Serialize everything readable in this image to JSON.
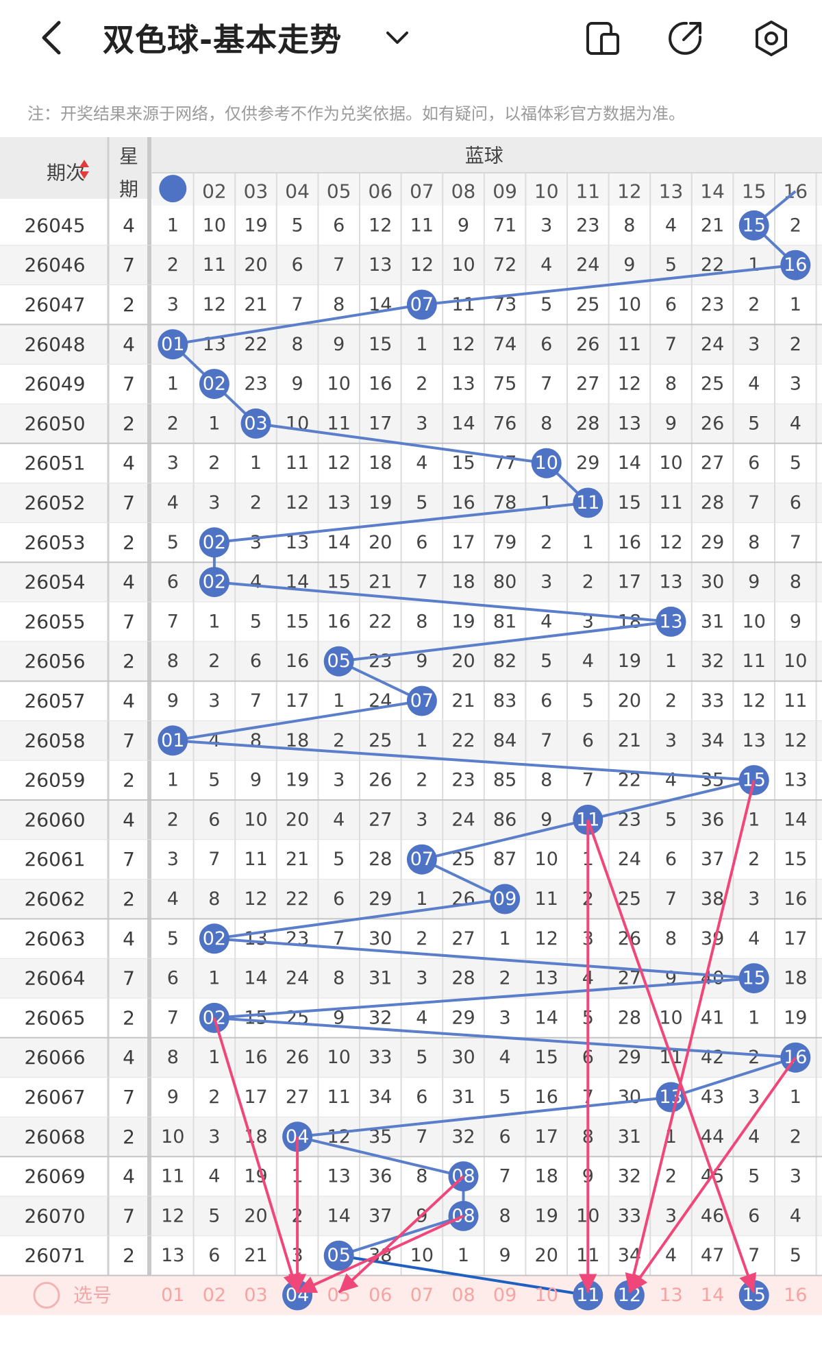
{
  "header": {
    "title": "双色球-基本走势",
    "note": "注：开奖结果来源于网络，仅供参考不作为兑奖依据。如有疑问，以福体彩官方数据为准。",
    "icons": [
      "back-icon",
      "chevron-down-icon",
      "device-icon",
      "share-icon",
      "settings-icon"
    ]
  },
  "table": {
    "col_issue": "期次",
    "col_week": "星期",
    "group_label": "蓝球",
    "columns": [
      "01",
      "02",
      "03",
      "04",
      "05",
      "06",
      "07",
      "08",
      "09",
      "10",
      "11",
      "12",
      "13",
      "14",
      "15",
      "16"
    ],
    "rows": [
      {
        "issue": "26045",
        "week": "4",
        "blue": 15,
        "cells": [
          "1",
          "10",
          "19",
          "5",
          "6",
          "12",
          "11",
          "9",
          "71",
          "3",
          "23",
          "8",
          "4",
          "21",
          "15",
          "2"
        ]
      },
      {
        "issue": "26046",
        "week": "7",
        "blue": 16,
        "cells": [
          "2",
          "11",
          "20",
          "6",
          "7",
          "13",
          "12",
          "10",
          "72",
          "4",
          "24",
          "9",
          "5",
          "22",
          "1",
          "16"
        ]
      },
      {
        "issue": "26047",
        "week": "2",
        "blue": 7,
        "cells": [
          "3",
          "12",
          "21",
          "7",
          "8",
          "14",
          "07",
          "11",
          "73",
          "5",
          "25",
          "10",
          "6",
          "23",
          "2",
          "1"
        ]
      },
      {
        "issue": "26048",
        "week": "4",
        "blue": 1,
        "cells": [
          "01",
          "13",
          "22",
          "8",
          "9",
          "15",
          "1",
          "12",
          "74",
          "6",
          "26",
          "11",
          "7",
          "24",
          "3",
          "2"
        ]
      },
      {
        "issue": "26049",
        "week": "7",
        "blue": 2,
        "cells": [
          "1",
          "02",
          "23",
          "9",
          "10",
          "16",
          "2",
          "13",
          "75",
          "7",
          "27",
          "12",
          "8",
          "25",
          "4",
          "3"
        ]
      },
      {
        "issue": "26050",
        "week": "2",
        "blue": 3,
        "cells": [
          "2",
          "1",
          "03",
          "10",
          "11",
          "17",
          "3",
          "14",
          "76",
          "8",
          "28",
          "13",
          "9",
          "26",
          "5",
          "4"
        ]
      },
      {
        "issue": "26051",
        "week": "4",
        "blue": 10,
        "cells": [
          "3",
          "2",
          "1",
          "11",
          "12",
          "18",
          "4",
          "15",
          "77",
          "10",
          "29",
          "14",
          "10",
          "27",
          "6",
          "5"
        ]
      },
      {
        "issue": "26052",
        "week": "7",
        "blue": 11,
        "cells": [
          "4",
          "3",
          "2",
          "12",
          "13",
          "19",
          "5",
          "16",
          "78",
          "1",
          "11",
          "15",
          "11",
          "28",
          "7",
          "6"
        ]
      },
      {
        "issue": "26053",
        "week": "2",
        "blue": 2,
        "cells": [
          "5",
          "02",
          "3",
          "13",
          "14",
          "20",
          "6",
          "17",
          "79",
          "2",
          "1",
          "16",
          "12",
          "29",
          "8",
          "7"
        ]
      },
      {
        "issue": "26054",
        "week": "4",
        "blue": 2,
        "cells": [
          "6",
          "02",
          "4",
          "14",
          "15",
          "21",
          "7",
          "18",
          "80",
          "3",
          "2",
          "17",
          "13",
          "30",
          "9",
          "8"
        ]
      },
      {
        "issue": "26055",
        "week": "7",
        "blue": 13,
        "cells": [
          "7",
          "1",
          "5",
          "15",
          "16",
          "22",
          "8",
          "19",
          "81",
          "4",
          "3",
          "18",
          "13",
          "31",
          "10",
          "9"
        ]
      },
      {
        "issue": "26056",
        "week": "2",
        "blue": 5,
        "cells": [
          "8",
          "2",
          "6",
          "16",
          "05",
          "23",
          "9",
          "20",
          "82",
          "5",
          "4",
          "19",
          "1",
          "32",
          "11",
          "10"
        ]
      },
      {
        "issue": "26057",
        "week": "4",
        "blue": 7,
        "cells": [
          "9",
          "3",
          "7",
          "17",
          "1",
          "24",
          "07",
          "21",
          "83",
          "6",
          "5",
          "20",
          "2",
          "33",
          "12",
          "11"
        ]
      },
      {
        "issue": "26058",
        "week": "7",
        "blue": 1,
        "cells": [
          "01",
          "4",
          "8",
          "18",
          "2",
          "25",
          "1",
          "22",
          "84",
          "7",
          "6",
          "21",
          "3",
          "34",
          "13",
          "12"
        ]
      },
      {
        "issue": "26059",
        "week": "2",
        "blue": 15,
        "cells": [
          "1",
          "5",
          "9",
          "19",
          "3",
          "26",
          "2",
          "23",
          "85",
          "8",
          "7",
          "22",
          "4",
          "35",
          "15",
          "13"
        ]
      },
      {
        "issue": "26060",
        "week": "4",
        "blue": 11,
        "cells": [
          "2",
          "6",
          "10",
          "20",
          "4",
          "27",
          "3",
          "24",
          "86",
          "9",
          "11",
          "23",
          "5",
          "36",
          "1",
          "14"
        ]
      },
      {
        "issue": "26061",
        "week": "7",
        "blue": 7,
        "cells": [
          "3",
          "7",
          "11",
          "21",
          "5",
          "28",
          "07",
          "25",
          "87",
          "10",
          "1",
          "24",
          "6",
          "37",
          "2",
          "15"
        ]
      },
      {
        "issue": "26062",
        "week": "2",
        "blue": 9,
        "cells": [
          "4",
          "8",
          "12",
          "22",
          "6",
          "29",
          "1",
          "26",
          "09",
          "11",
          "2",
          "25",
          "7",
          "38",
          "3",
          "16"
        ]
      },
      {
        "issue": "26063",
        "week": "4",
        "blue": 2,
        "cells": [
          "5",
          "02",
          "13",
          "23",
          "7",
          "30",
          "2",
          "27",
          "1",
          "12",
          "3",
          "26",
          "8",
          "39",
          "4",
          "17"
        ]
      },
      {
        "issue": "26064",
        "week": "7",
        "blue": 15,
        "cells": [
          "6",
          "1",
          "14",
          "24",
          "8",
          "31",
          "3",
          "28",
          "2",
          "13",
          "4",
          "27",
          "9",
          "40",
          "15",
          "18"
        ]
      },
      {
        "issue": "26065",
        "week": "2",
        "blue": 2,
        "cells": [
          "7",
          "02",
          "15",
          "25",
          "9",
          "32",
          "4",
          "29",
          "3",
          "14",
          "5",
          "28",
          "10",
          "41",
          "1",
          "19"
        ]
      },
      {
        "issue": "26066",
        "week": "4",
        "blue": 16,
        "cells": [
          "8",
          "1",
          "16",
          "26",
          "10",
          "33",
          "5",
          "30",
          "4",
          "15",
          "6",
          "29",
          "11",
          "42",
          "2",
          "16"
        ]
      },
      {
        "issue": "26067",
        "week": "7",
        "blue": 13,
        "cells": [
          "9",
          "2",
          "17",
          "27",
          "11",
          "34",
          "6",
          "31",
          "5",
          "16",
          "7",
          "30",
          "13",
          "43",
          "3",
          "1"
        ]
      },
      {
        "issue": "26068",
        "week": "2",
        "blue": 4,
        "cells": [
          "10",
          "3",
          "18",
          "04",
          "12",
          "35",
          "7",
          "32",
          "6",
          "17",
          "8",
          "31",
          "1",
          "44",
          "4",
          "2"
        ]
      },
      {
        "issue": "26069",
        "week": "4",
        "blue": 8,
        "cells": [
          "11",
          "4",
          "19",
          "1",
          "13",
          "36",
          "8",
          "08",
          "7",
          "18",
          "9",
          "32",
          "2",
          "45",
          "5",
          "3"
        ]
      },
      {
        "issue": "26070",
        "week": "7",
        "blue": 8,
        "cells": [
          "12",
          "5",
          "20",
          "2",
          "14",
          "37",
          "9",
          "08",
          "8",
          "19",
          "10",
          "33",
          "3",
          "46",
          "6",
          "4"
        ]
      },
      {
        "issue": "26071",
        "week": "2",
        "blue": 5,
        "cells": [
          "13",
          "6",
          "21",
          "3",
          "05",
          "38",
          "10",
          "1",
          "9",
          "20",
          "11",
          "34",
          "4",
          "47",
          "7",
          "5"
        ]
      }
    ],
    "select_label": "选号",
    "select_numbers": [
      "01",
      "02",
      "03",
      "04",
      "05",
      "06",
      "07",
      "08",
      "09",
      "10",
      "11",
      "12",
      "13",
      "14",
      "15",
      "16"
    ],
    "selected": [
      4,
      11,
      12,
      15
    ],
    "colors": {
      "ball": "#4e72c4",
      "line": "#5b7ecb",
      "arrow": "#f0477a",
      "pick_text": "#f6a3a3",
      "pick_row_bg": "#fdecea"
    }
  }
}
